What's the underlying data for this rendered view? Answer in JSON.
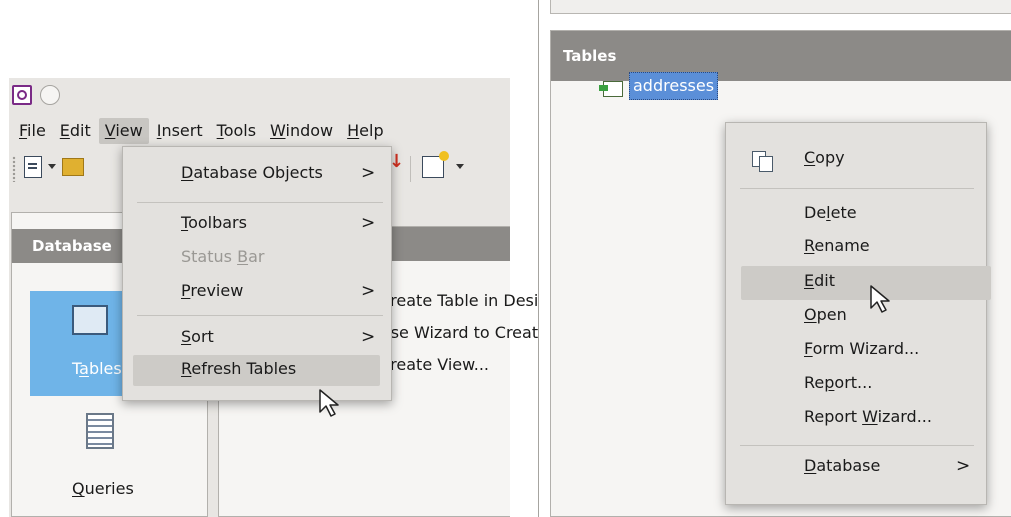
{
  "left": {
    "menubar": [
      {
        "pre": "",
        "u": "F",
        "post": "ile"
      },
      {
        "pre": "",
        "u": "E",
        "post": "dit"
      },
      {
        "pre": "",
        "u": "V",
        "post": "iew"
      },
      {
        "pre": "",
        "u": "I",
        "post": "nsert"
      },
      {
        "pre": "",
        "u": "T",
        "post": "ools"
      },
      {
        "pre": "",
        "u": "W",
        "post": "indow"
      },
      {
        "pre": "",
        "u": "H",
        "post": "elp"
      }
    ],
    "database_header": "Database",
    "tables_label": {
      "pre": "T",
      "u": "a",
      "post": "bles"
    },
    "queries_label": {
      "pre": "",
      "u": "Q",
      "post": "ueries"
    },
    "tasks": [
      "Create Table in Design View...",
      "Use Wizard to Create Table...",
      "Create View..."
    ],
    "view_menu": {
      "database_objects": {
        "pre": "",
        "u": "D",
        "post": "atabase Objects"
      },
      "toolbars": {
        "pre": "",
        "u": "T",
        "post": "oolbars"
      },
      "status_bar": {
        "pre": "Status ",
        "u": "B",
        "post": "ar"
      },
      "preview": {
        "pre": "",
        "u": "P",
        "post": "review"
      },
      "sort": {
        "pre": "",
        "u": "S",
        "post": "ort"
      },
      "refresh_tables": {
        "pre": "",
        "u": "R",
        "post": "efresh Tables"
      },
      "submenu_arrow": ">"
    }
  },
  "right": {
    "tables_header": "Tables",
    "table_name": "addresses",
    "context_menu": {
      "copy": {
        "pre": "",
        "u": "C",
        "post": "opy"
      },
      "delete": {
        "pre": "De",
        "u": "l",
        "post": "ete"
      },
      "rename": {
        "pre": "",
        "u": "R",
        "post": "ename"
      },
      "edit": {
        "pre": "",
        "u": "E",
        "post": "dit"
      },
      "open": {
        "pre": "",
        "u": "O",
        "post": "pen"
      },
      "form_wizard": {
        "pre": "",
        "u": "F",
        "post": "orm Wizard..."
      },
      "report": {
        "pre": "Re",
        "u": "p",
        "post": "ort..."
      },
      "report_wizard": {
        "pre": "Report ",
        "u": "W",
        "post": "izard..."
      },
      "database": {
        "pre": "",
        "u": "D",
        "post": "atabase"
      },
      "submenu_arrow": ">"
    }
  },
  "icons": {
    "app": "base-app-icon",
    "new_doc": "new-document-icon",
    "open": "open-folder-icon",
    "sort": "sort-descending-icon",
    "form": "form-wizard-icon",
    "tables": "tables-icon",
    "queries": "queries-icon",
    "table_item": "table-item-icon",
    "copy": "copy-icon",
    "cursor": "mouse-pointer-icon"
  },
  "colors": {
    "header_bg": "#8c8a87",
    "menu_bg": "#e3e1de",
    "highlight": "#cdcbc7",
    "selection_blue": "#5b8fd8",
    "tables_selected": "#6fb4e8"
  }
}
